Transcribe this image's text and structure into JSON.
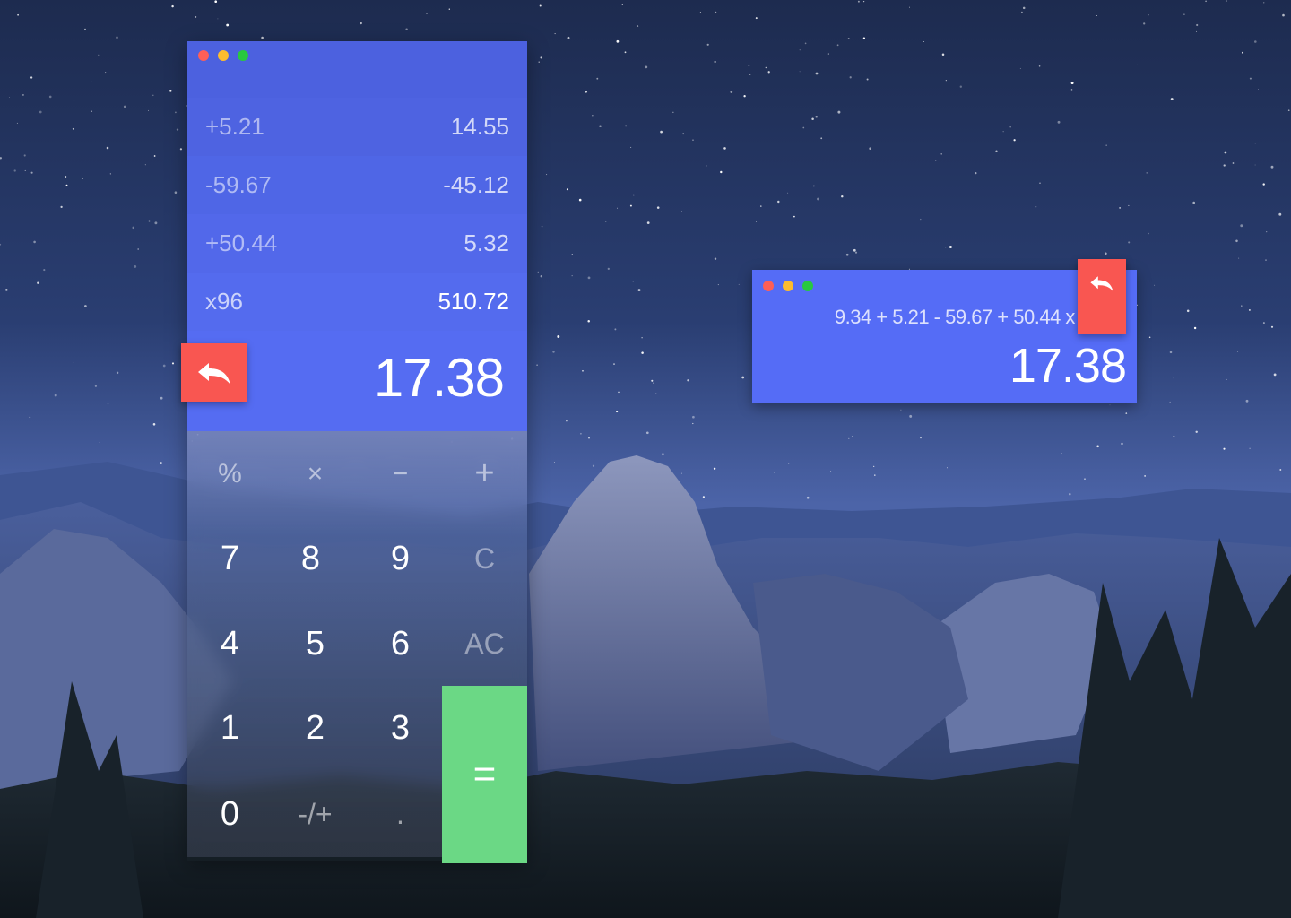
{
  "calculator": {
    "history": [
      {
        "operation": "+5.21",
        "result": "14.55"
      },
      {
        "operation": "-59.67",
        "result": "-45.12"
      },
      {
        "operation": "+50.44",
        "result": "5.32"
      },
      {
        "operation": "x96",
        "result": "510.72"
      }
    ],
    "display_value": "17.38",
    "undo_icon": "undo-arrow-icon",
    "keys": {
      "percent": "%",
      "multiply": "×",
      "subtract": "−",
      "add": "+",
      "seven": "7",
      "eight": "8",
      "nine": "9",
      "clear": "C",
      "four": "4",
      "five": "5",
      "six": "6",
      "all_clear": "AC",
      "one": "1",
      "two": "2",
      "three": "3",
      "zero": "0",
      "negate": "-/+",
      "decimal": ".",
      "equals": "="
    }
  },
  "mini_calculator": {
    "expression": "9.34 + 5.21 - 59.67 + 50.44 x 96",
    "display_value": "17.38",
    "undo_icon": "undo-arrow-icon"
  },
  "colors": {
    "accent_blue": "#556cf2",
    "undo_red": "#f95651",
    "equals_green": "#6bd885"
  }
}
